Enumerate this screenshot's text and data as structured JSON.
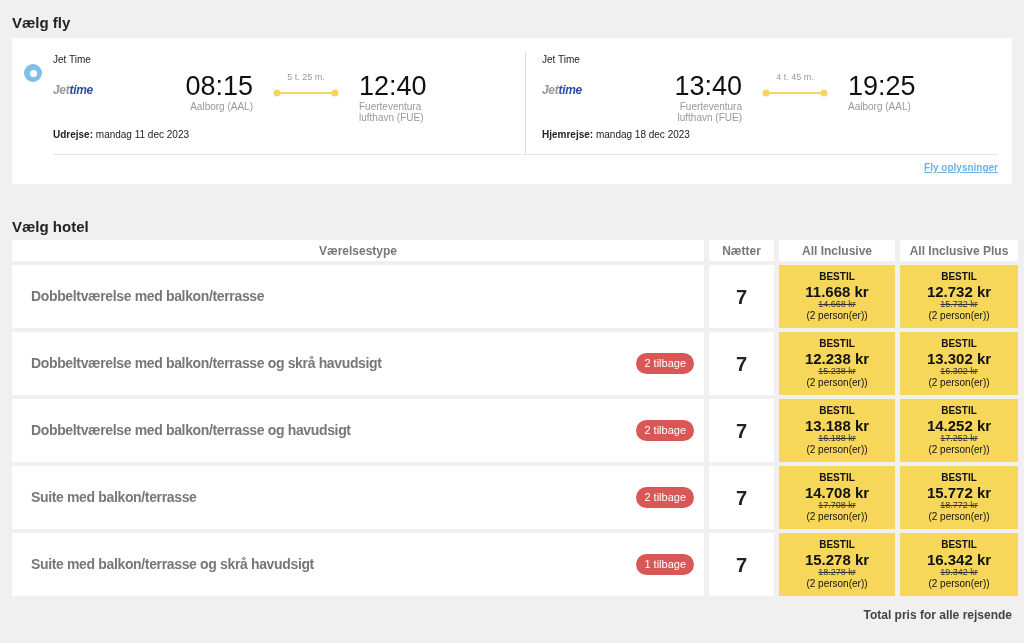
{
  "flight_section": {
    "title": "Vælg fly",
    "selected": true,
    "legs": [
      {
        "airline": "Jet Time",
        "logo": {
          "part1": "Jet",
          "part2": "time"
        },
        "depart_time": "08:15",
        "depart_place": "Aalborg (AAL)",
        "duration": "5 t. 25 m.",
        "arrive_time": "12:40",
        "arrive_place": "Fuerteventura lufthavn (FUE)",
        "date_label": "Udrejse:",
        "date": "mandag 11 dec 2023"
      },
      {
        "airline": "Jet Time",
        "logo": {
          "part1": "Jet",
          "part2": "time"
        },
        "depart_time": "13:40",
        "depart_place": "Fuerteventura lufthavn (FUE)",
        "duration": "4 t. 45 m.",
        "arrive_time": "19:25",
        "arrive_place": "Aalborg (AAL)",
        "date_label": "Hjemrejse:",
        "date": "mandag 18 dec 2023"
      }
    ],
    "details_link": "Fly oplysninger"
  },
  "hotel_section": {
    "title": "Vælg hotel",
    "columns": [
      "Værelsestype",
      "Nætter",
      "All Inclusive",
      "All Inclusive Plus"
    ],
    "rows": [
      {
        "room": "Dobbeltværelse med balkon/terrasse",
        "nights": "7",
        "offers": [
          {
            "action": "BESTIL",
            "price": "11.668 kr",
            "old_price": "14.668 kr",
            "persons": "(2 person(er))"
          },
          {
            "action": "BESTIL",
            "price": "12.732 kr",
            "old_price": "15.732 kr",
            "persons": "(2 person(er))"
          }
        ]
      },
      {
        "room": "Dobbeltværelse med balkon/terrasse og skrå havudsigt",
        "badge": "2 tilbage",
        "nights": "7",
        "offers": [
          {
            "action": "BESTIL",
            "price": "12.238 kr",
            "old_price": "15.238 kr",
            "persons": "(2 person(er))"
          },
          {
            "action": "BESTIL",
            "price": "13.302 kr",
            "old_price": "16.302 kr",
            "persons": "(2 person(er))"
          }
        ]
      },
      {
        "room": "Dobbeltværelse med balkon/terrasse og havudsigt",
        "badge": "2 tilbage",
        "nights": "7",
        "offers": [
          {
            "action": "BESTIL",
            "price": "13.188 kr",
            "old_price": "16.188 kr",
            "persons": "(2 person(er))"
          },
          {
            "action": "BESTIL",
            "price": "14.252 kr",
            "old_price": "17.252 kr",
            "persons": "(2 person(er))"
          }
        ]
      },
      {
        "room": "Suite med balkon/terrasse",
        "badge": "2 tilbage",
        "nights": "7",
        "offers": [
          {
            "action": "BESTIL",
            "price": "14.708 kr",
            "old_price": "17.708 kr",
            "persons": "(2 person(er))"
          },
          {
            "action": "BESTIL",
            "price": "15.772 kr",
            "old_price": "18.772 kr",
            "persons": "(2 person(er))"
          }
        ]
      },
      {
        "room": "Suite med balkon/terrasse og skrå havudsigt",
        "badge": "1 tilbage",
        "nights": "7",
        "offers": [
          {
            "action": "BESTIL",
            "price": "15.278 kr",
            "old_price": "18.278 kr",
            "persons": "(2 person(er))"
          },
          {
            "action": "BESTIL",
            "price": "16.342 kr",
            "old_price": "19.342 kr",
            "persons": "(2 person(er))"
          }
        ]
      }
    ],
    "footer": "Total pris for alle rejsende"
  }
}
